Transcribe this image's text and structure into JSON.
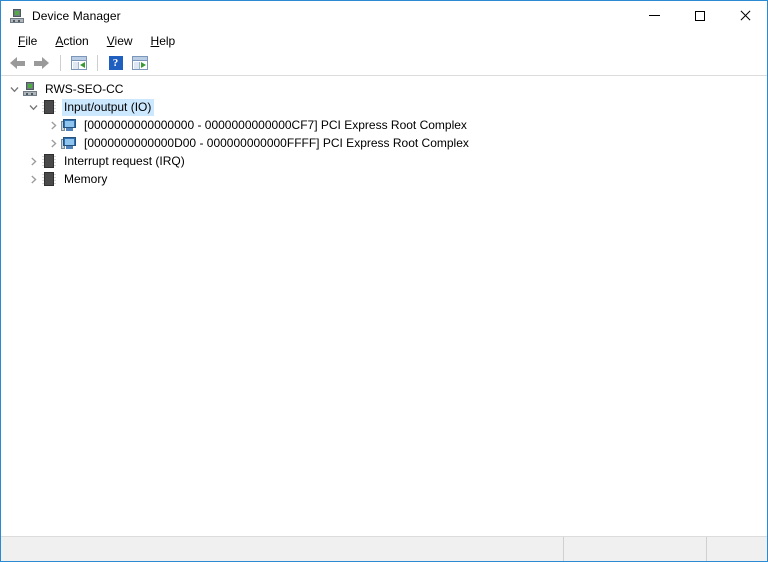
{
  "window": {
    "title": "Device Manager",
    "icon": "device-manager-icon",
    "controls": {
      "minimize": "Minimize",
      "maximize": "Maximize",
      "close": "Close"
    }
  },
  "menu": {
    "items": [
      {
        "label": "File",
        "accel": "F"
      },
      {
        "label": "Action",
        "accel": "A"
      },
      {
        "label": "View",
        "accel": "V"
      },
      {
        "label": "Help",
        "accel": "H"
      }
    ]
  },
  "toolbar": {
    "buttons": [
      {
        "name": "back-button",
        "icon": "back-arrow-icon",
        "label": "Back"
      },
      {
        "name": "forward-button",
        "icon": "forward-arrow-icon",
        "label": "Forward"
      },
      {
        "name": "show-console-tree-button",
        "icon": "console-tree-icon",
        "label": "Show/Hide Console Tree"
      },
      {
        "name": "help-button",
        "icon": "help-question-icon",
        "label": "Help"
      },
      {
        "name": "show-action-pane-button",
        "icon": "action-pane-icon",
        "label": "Show/Hide Action Pane"
      }
    ]
  },
  "tree": {
    "root": {
      "label": "RWS-SEO-CC",
      "icon": "computer-icon",
      "expanded": true,
      "chevron": "chevron-down"
    },
    "nodes": [
      {
        "label": "Input/output (IO)",
        "icon": "resource-icon",
        "indent": 1,
        "expanded": true,
        "selected": true,
        "chevron": "chevron-down",
        "children": [
          {
            "label": "[0000000000000000 - 0000000000000CF7]  PCI Express Root Complex",
            "range_start": "0000000000000000",
            "range_end": "0000000000000CF7",
            "device": "PCI Express Root Complex",
            "icon": "device-monitor-icon",
            "indent": 2,
            "expanded": false,
            "chevron": "chevron-right"
          },
          {
            "label": "[0000000000000D00 - 000000000000FFFF]  PCI Express Root Complex",
            "range_start": "0000000000000D00",
            "range_end": "000000000000FFFF",
            "device": "PCI Express Root Complex",
            "icon": "device-monitor-icon",
            "indent": 2,
            "expanded": false,
            "chevron": "chevron-right"
          }
        ]
      },
      {
        "label": "Interrupt request (IRQ)",
        "icon": "resource-icon",
        "indent": 1,
        "expanded": false,
        "selected": false,
        "chevron": "chevron-right",
        "children": []
      },
      {
        "label": "Memory",
        "icon": "resource-icon",
        "indent": 1,
        "expanded": false,
        "selected": false,
        "chevron": "chevron-right",
        "children": []
      }
    ]
  },
  "statusbar": {
    "panel1": "",
    "panel2": "",
    "panel3": ""
  },
  "colors": {
    "window_border": "#2a8ad4",
    "selection": "#cce8ff",
    "status_bg": "#f0f0f0",
    "chevron": "#767676",
    "accent_blue": "#1f5fbf"
  }
}
